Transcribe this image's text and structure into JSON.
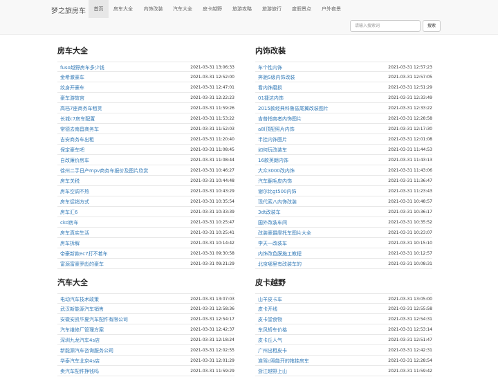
{
  "site": {
    "brand": "梦之旅房车"
  },
  "nav": [
    "首页",
    "房车大全",
    "内饰改装",
    "汽车大全",
    "皮卡越野",
    "旅游攻略",
    "旅游旅行",
    "度假景点",
    "户外夜景"
  ],
  "search": {
    "placeholder": "请输入搜索词",
    "button": "搜索"
  },
  "sections": [
    {
      "title": "房车大全",
      "items": [
        {
          "title": "fuso越野房车多少钱",
          "date": "2021-03-31 13:06:33"
        },
        {
          "title": "金希澈豪车",
          "date": "2021-03-31 12:52:00"
        },
        {
          "title": "纹身开豪车",
          "date": "2021-03-31 12:47:01"
        },
        {
          "title": "豪车游故宫",
          "date": "2021-03-31 12:22:23"
        },
        {
          "title": "高档7座商务车租赁",
          "date": "2021-03-31 11:59:26"
        },
        {
          "title": "长城c7房车配置",
          "date": "2021-03-31 11:53:22"
        },
        {
          "title": "常德去南昌商务车",
          "date": "2021-03-31 11:52:03"
        },
        {
          "title": "吉安商务车出租",
          "date": "2021-03-31 11:20:40"
        },
        {
          "title": "保定豪车吧",
          "date": "2021-03-31 11:08:45"
        },
        {
          "title": "自改廉价房车",
          "date": "2021-03-31 11:08:44"
        },
        {
          "title": "徐州二手日产mpv商务车报价及图片欣赏",
          "date": "2021-03-31 10:46:27"
        },
        {
          "title": "房车关税",
          "date": "2021-03-31 10:44:48"
        },
        {
          "title": "房车空调不热",
          "date": "2021-03-31 10:43:29"
        },
        {
          "title": "房车促销方式",
          "date": "2021-03-31 10:35:54"
        },
        {
          "title": "房车汇6",
          "date": "2021-03-31 10:33:39"
        },
        {
          "title": "ckd房车",
          "date": "2021-03-31 10:25:47"
        },
        {
          "title": "房车真实生活",
          "date": "2021-03-31 10:25:41"
        },
        {
          "title": "房车拆解",
          "date": "2021-03-31 10:14:42"
        },
        {
          "title": "帝豪新款ec7打不着车",
          "date": "2021-03-31 09:30:58"
        },
        {
          "title": "富源富豪罗彪的豪车",
          "date": "2021-03-31 09:21:29"
        }
      ]
    },
    {
      "title": "内饰改装",
      "items": [
        {
          "title": "车个性内饰",
          "date": "2021-03-31 12:57:23"
        },
        {
          "title": "奔驰S级内饰改装",
          "date": "2021-03-31 12:57:05"
        },
        {
          "title": "看内饰磨损",
          "date": "2021-03-31 12:51:29"
        },
        {
          "title": "01捷达内饰",
          "date": "2021-03-31 12:33:49"
        },
        {
          "title": "2015款经典科鲁兹尾翼改装图片",
          "date": "2021-03-31 12:33:22"
        },
        {
          "title": "吉普指南者内饰图片",
          "date": "2021-03-31 12:28:58"
        },
        {
          "title": "a8l顶配照片内饰",
          "date": "2021-03-31 12:17:30"
        },
        {
          "title": "半挂内饰图片",
          "date": "2021-03-31 12:01:08"
        },
        {
          "title": "如何玩改装车",
          "date": "2021-03-31 11:44:53"
        },
        {
          "title": "16款英朗内饰",
          "date": "2021-03-31 11:43:13"
        },
        {
          "title": "大众3000改内饰",
          "date": "2021-03-31 11:43:06"
        },
        {
          "title": "汽车翻毛皮内饰",
          "date": "2021-03-31 11:36:47"
        },
        {
          "title": "谢尔比gt500内饰",
          "date": "2021-03-31 11:23:43"
        },
        {
          "title": "现代索八内饰改装",
          "date": "2021-03-31 10:48:57"
        },
        {
          "title": "3dt改装车",
          "date": "2021-03-31 10:36:17"
        },
        {
          "title": "国外改装车间",
          "date": "2021-03-31 10:35:52"
        },
        {
          "title": "改装豪爵摩托车图片大全",
          "date": "2021-03-31 10:23:07"
        },
        {
          "title": "李天一改装车",
          "date": "2021-03-31 10:15:10"
        },
        {
          "title": "内饰改色膜施工教程",
          "date": "2021-03-31 10:12:57"
        },
        {
          "title": "北京哪里有改装车的",
          "date": "2021-03-31 10:08:31"
        }
      ]
    },
    {
      "title": "汽车大全",
      "items": [
        {
          "title": "电动汽车技术政策",
          "date": "2021-03-31 13:07:03"
        },
        {
          "title": "武汉新能源汽车销售",
          "date": "2021-03-31 12:58:36"
        },
        {
          "title": "安徽安凯华夏汽车配件有限公司",
          "date": "2021-03-31 12:54:17"
        },
        {
          "title": "汽车维修厂管理方案",
          "date": "2021-03-31 12:42:37"
        },
        {
          "title": "深圳九龙汽车4s店",
          "date": "2021-03-31 12:18:24"
        },
        {
          "title": "新能源汽车咨询服务公司",
          "date": "2021-03-31 12:02:55"
        },
        {
          "title": "华泰汽车北京4s店",
          "date": "2021-03-31 12:01:29"
        },
        {
          "title": "卖汽车配件挣钱吗",
          "date": "2021-03-31 11:59:29"
        }
      ]
    },
    {
      "title": "皮卡越野",
      "items": [
        {
          "title": "山羊皮卡车",
          "date": "2021-03-31 13:05:00"
        },
        {
          "title": "皮卡开线",
          "date": "2021-03-31 12:55:58"
        },
        {
          "title": "皮卡堂食物",
          "date": "2021-03-31 12:54:31"
        },
        {
          "title": "东风轿车价格",
          "date": "2021-03-31 12:53:14"
        },
        {
          "title": "皮卡丘人气",
          "date": "2021-03-31 12:51:47"
        },
        {
          "title": "广州出租皮卡",
          "date": "2021-03-31 12:42:31"
        },
        {
          "title": "准驾c照能开的拖挂房车",
          "date": "2021-03-31 12:28:54"
        },
        {
          "title": "浙江越野上山",
          "date": "2021-03-31 11:59:42"
        }
      ]
    }
  ]
}
